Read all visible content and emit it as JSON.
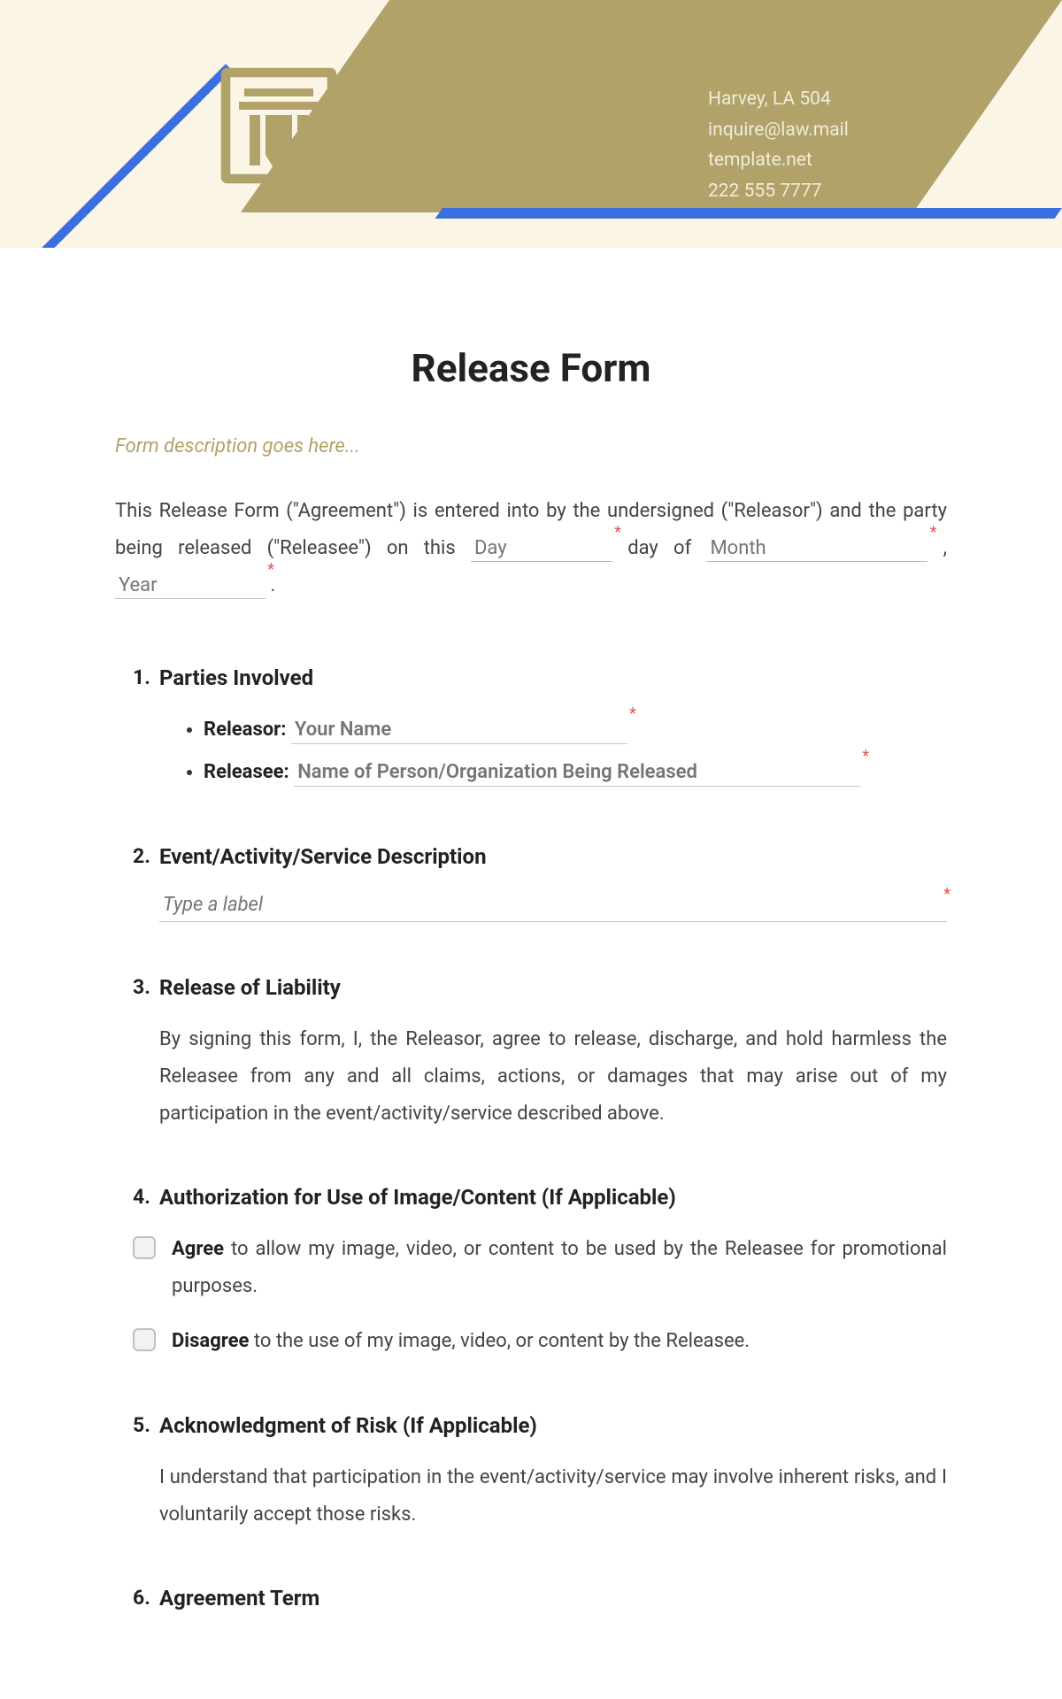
{
  "header": {
    "contact": {
      "address": "Harvey, LA 504",
      "email": "inquire@law.mail",
      "website": "template.net",
      "phone": "222 555 7777"
    }
  },
  "title": "Release Form",
  "form_description_placeholder": "Form description goes here...",
  "intro": {
    "text1": "This Release Form (\"Agreement\") is entered into by the undersigned (\"Releasor\") and the party being released (\"Releasee\") on this",
    "day_placeholder": "Day",
    "text2": "day of",
    "month_placeholder": "Month",
    "text3": ",",
    "year_placeholder": "Year",
    "text4": "."
  },
  "sections": {
    "s1": {
      "title": "Parties Involved",
      "releasor_label": "Releasor:",
      "releasor_placeholder": "Your Name",
      "releasee_label": "Releasee:",
      "releasee_placeholder": "Name of Person/Organization Being Released"
    },
    "s2": {
      "title": "Event/Activity/Service Description",
      "placeholder": "Type a label"
    },
    "s3": {
      "title": "Release of Liability",
      "body": "By signing this form, I, the Releasor, agree to release, discharge, and hold harmless the Releasee from any and all claims, actions, or damages that may arise out of my participation in the event/activity/service described above."
    },
    "s4": {
      "title": "Authorization for Use of Image/Content (If Applicable)",
      "agree_bold": "Agree",
      "agree_rest": " to allow my image, video, or content to be used by the Releasee for promotional purposes.",
      "disagree_bold": "Disagree",
      "disagree_rest": " to the use of my image, video, or content by the Releasee."
    },
    "s5": {
      "title": "Acknowledgment of Risk (If Applicable)",
      "body": "I understand that participation in the event/activity/service may involve inherent risks, and I voluntarily accept those risks."
    },
    "s6": {
      "title": "Agreement Term"
    }
  }
}
